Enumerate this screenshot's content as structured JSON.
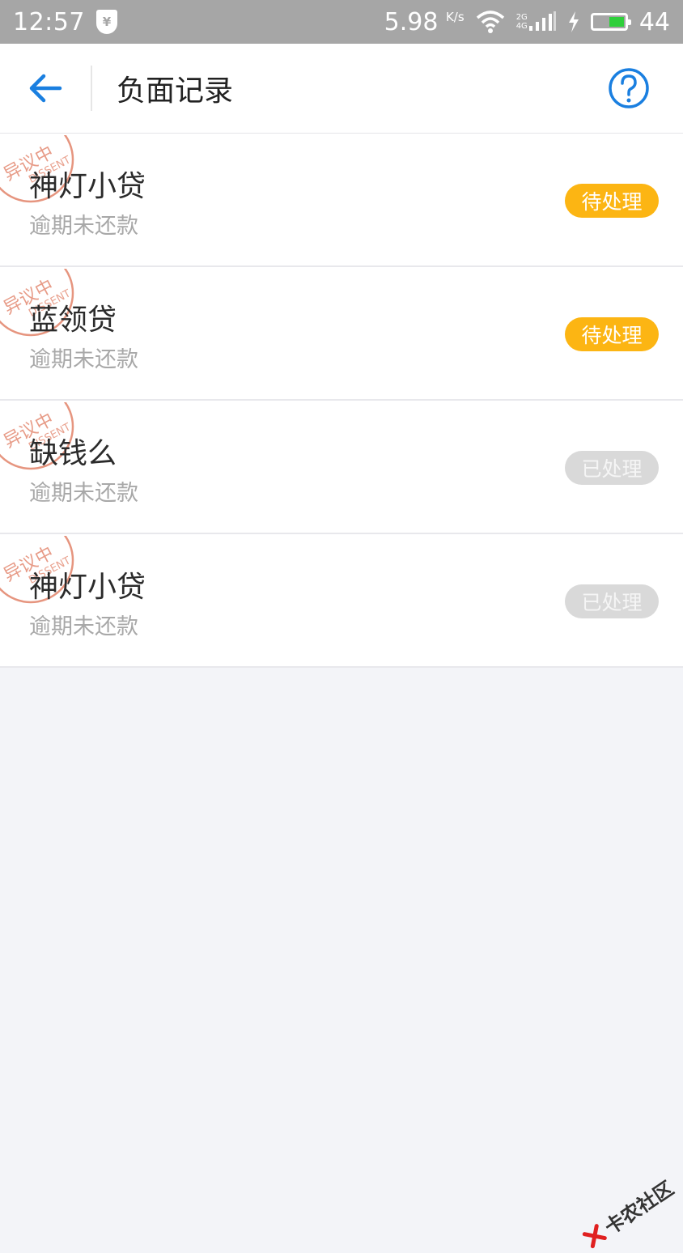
{
  "status_bar": {
    "time": "12:57",
    "shield_glyph": "¥",
    "speed_value": "5.98",
    "speed_unit": "K/s",
    "net_top": "2G",
    "net_bottom": "4G",
    "battery_level": "44"
  },
  "header": {
    "title": "负面记录",
    "back_icon": "arrow-left-icon",
    "help_icon": "question-circle-icon",
    "accent_color": "#1a7fe0"
  },
  "stamp": {
    "top_text": "异议中",
    "bottom_text": "DISSENT",
    "color": "#e07a5f"
  },
  "records": [
    {
      "name": "神灯小贷",
      "desc": "逾期未还款",
      "status": "待处理",
      "state": "pending"
    },
    {
      "name": "蓝领贷",
      "desc": "逾期未还款",
      "status": "待处理",
      "state": "pending"
    },
    {
      "name": "缺钱么",
      "desc": "逾期未还款",
      "status": "已处理",
      "state": "done"
    },
    {
      "name": "神灯小贷",
      "desc": "逾期未还款",
      "status": "已处理",
      "state": "done"
    }
  ],
  "watermark": {
    "text": "卡农社区"
  },
  "colors": {
    "pending": "#fcb513",
    "done": "#d9d9d9",
    "background": "#f3f4f8"
  }
}
